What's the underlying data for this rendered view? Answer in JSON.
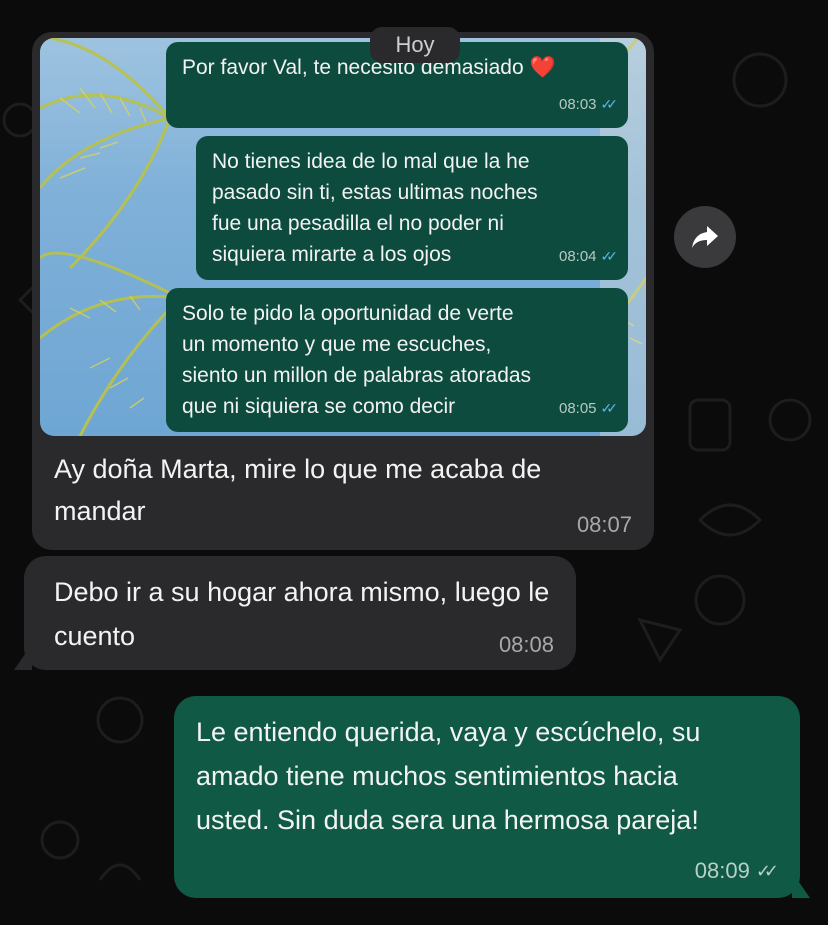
{
  "date_divider": "Hoy",
  "image_message": {
    "inner_messages": [
      {
        "text": "Por favor Val, te necesito demasiado ❤️",
        "time": "08:03"
      },
      {
        "text": "No tienes idea de lo mal que la he pasado sin ti, estas ultimas noches fue una pesadilla el no poder ni siquiera mirarte a los ojos",
        "time": "08:04"
      },
      {
        "text": "Solo te pido la oportunidad de verte un momento y que me escuches, siento un millon de palabras atoradas que ni siquiera se como decir",
        "time": "08:05"
      }
    ],
    "caption": "Ay doña Marta, mire lo que me acaba de mandar",
    "time": "08:07"
  },
  "incoming_message": {
    "text": "Debo ir a su hogar ahora mismo, luego le cuento",
    "time": "08:08"
  },
  "outgoing_message": {
    "text": "Le entiendo querida, vaya y escúchelo, su amado tiene muchos sentimientos hacia usted. Sin duda sera una hermosa pareja!",
    "time": "08:09"
  },
  "icons": {
    "forward": "forward-icon",
    "read_receipt": "double-check-icon"
  },
  "colors": {
    "incoming_bubble": "#2a2a2c",
    "outgoing_bubble": "#0f5945",
    "background": "#0b0b0b"
  }
}
